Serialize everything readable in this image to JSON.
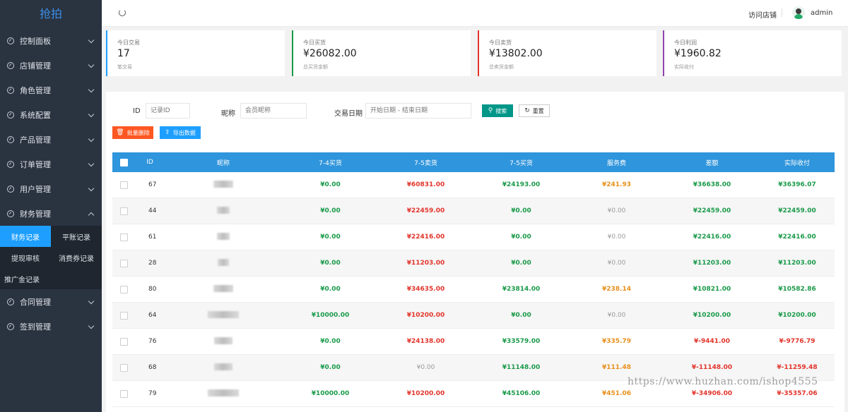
{
  "app": {
    "logo": "抢拍"
  },
  "sidebar": {
    "items": [
      {
        "label": "控制面板"
      },
      {
        "label": "店铺管理"
      },
      {
        "label": "角色管理"
      },
      {
        "label": "系统配置"
      },
      {
        "label": "产品管理"
      },
      {
        "label": "订单管理"
      },
      {
        "label": "用户管理"
      },
      {
        "label": "财务管理"
      }
    ],
    "finance_sub": {
      "row1": [
        "财务记录",
        "平账记录"
      ],
      "row2": [
        "提现审核",
        "消费券记录"
      ],
      "single": "推广金记录"
    },
    "items_after": [
      {
        "label": "合同管理"
      },
      {
        "label": "签到管理"
      }
    ]
  },
  "header": {
    "visit_shop": "访问店铺",
    "username": "admin"
  },
  "cards": [
    {
      "title": "今日交易",
      "value": "17",
      "sub": "笔交易",
      "color": "#1e9fff"
    },
    {
      "title": "今日买货",
      "value": "¥26082.00",
      "sub": "总买货金额",
      "color": "#1a9a4a"
    },
    {
      "title": "今日卖货",
      "value": "¥13802.00",
      "sub": "总卖货金额",
      "color": "#e2342b"
    },
    {
      "title": "今日利润",
      "value": "¥1960.82",
      "sub": "实际收付",
      "color": "#8e44ad"
    }
  ],
  "filters": {
    "id_label": "ID",
    "id_placeholder": "记录ID",
    "nick_label": "昵称",
    "nick_placeholder": "会员昵称",
    "date_label": "交易日期",
    "date_placeholder": "开始日期 - 结束日期",
    "search_btn": "搜索",
    "reset_btn": "重置",
    "batch_delete_btn": "批量删除",
    "export_btn": "导出数据"
  },
  "table": {
    "headers": [
      "ID",
      "昵称",
      "7-4买货",
      "7-5卖货",
      "7-5买货",
      "服务费",
      "差额",
      "实际收付"
    ],
    "rows": [
      {
        "id": "67",
        "buy74": "¥0.00",
        "sell75": "¥60831.00",
        "buy75": "¥24193.00",
        "fee": "¥241.93",
        "diff": "¥36638.00",
        "actual": "¥36396.07"
      },
      {
        "id": "44",
        "buy74": "¥0.00",
        "sell75": "¥22459.00",
        "buy75": "¥0.00",
        "fee": "¥0.00",
        "diff": "¥22459.00",
        "actual": "¥22459.00"
      },
      {
        "id": "61",
        "buy74": "¥0.00",
        "sell75": "¥22416.00",
        "buy75": "¥0.00",
        "fee": "¥0.00",
        "diff": "¥22416.00",
        "actual": "¥22416.00"
      },
      {
        "id": "28",
        "buy74": "¥0.00",
        "sell75": "¥11203.00",
        "buy75": "¥0.00",
        "fee": "¥0.00",
        "diff": "¥11203.00",
        "actual": "¥11203.00"
      },
      {
        "id": "80",
        "buy74": "¥0.00",
        "sell75": "¥34635.00",
        "buy75": "¥23814.00",
        "fee": "¥238.14",
        "diff": "¥10821.00",
        "actual": "¥10582.86"
      },
      {
        "id": "64",
        "buy74": "¥10000.00",
        "sell75": "¥10200.00",
        "buy75": "¥0.00",
        "fee": "¥0.00",
        "diff": "¥10200.00",
        "actual": "¥10200.00"
      },
      {
        "id": "76",
        "buy74": "¥0.00",
        "sell75": "¥24138.00",
        "buy75": "¥33579.00",
        "fee": "¥335.79",
        "diff": "¥-9441.00",
        "actual": "¥-9776.79"
      },
      {
        "id": "68",
        "buy74": "¥0.00",
        "sell75": "¥0.00",
        "buy75": "¥11148.00",
        "fee": "¥111.48",
        "diff": "¥-11148.00",
        "actual": "¥-11259.48"
      },
      {
        "id": "79",
        "buy74": "¥10000.00",
        "sell75": "¥10200.00",
        "buy75": "¥45106.00",
        "fee": "¥451.06",
        "diff": "¥-34906.00",
        "actual": "¥-35357.06"
      }
    ]
  },
  "watermark": "https://www.huzhan.com/ishop4555"
}
